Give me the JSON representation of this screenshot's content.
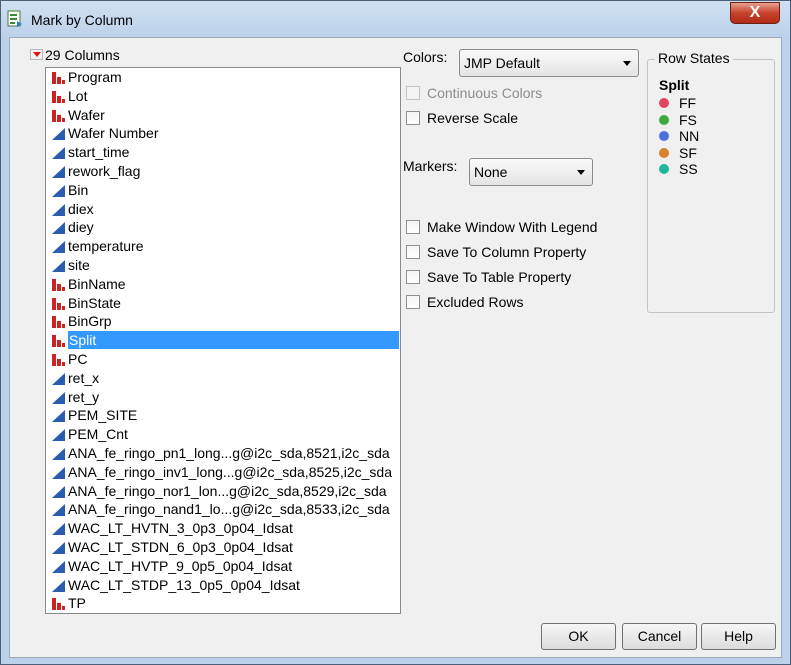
{
  "window": {
    "title": "Mark by Column",
    "close_label": "X"
  },
  "columns": {
    "header": "29 Columns",
    "items": [
      {
        "label": "Program",
        "type": "nominal"
      },
      {
        "label": "Lot",
        "type": "nominal"
      },
      {
        "label": "Wafer",
        "type": "nominal"
      },
      {
        "label": "Wafer Number",
        "type": "continuous"
      },
      {
        "label": "start_time",
        "type": "continuous"
      },
      {
        "label": "rework_flag",
        "type": "continuous"
      },
      {
        "label": "Bin",
        "type": "continuous"
      },
      {
        "label": "diex",
        "type": "continuous"
      },
      {
        "label": "diey",
        "type": "continuous"
      },
      {
        "label": "temperature",
        "type": "continuous"
      },
      {
        "label": "site",
        "type": "continuous"
      },
      {
        "label": "BinName",
        "type": "nominal"
      },
      {
        "label": "BinState",
        "type": "nominal"
      },
      {
        "label": "BinGrp",
        "type": "nominal"
      },
      {
        "label": "Split",
        "type": "nominal",
        "selected": true
      },
      {
        "label": "PC",
        "type": "nominal"
      },
      {
        "label": "ret_x",
        "type": "continuous"
      },
      {
        "label": "ret_y",
        "type": "continuous"
      },
      {
        "label": "PEM_SITE",
        "type": "continuous"
      },
      {
        "label": "PEM_Cnt",
        "type": "continuous"
      },
      {
        "label": "ANA_fe_ringo_pn1_long...g@i2c_sda,8521,i2c_sda",
        "type": "continuous"
      },
      {
        "label": "ANA_fe_ringo_inv1_long...g@i2c_sda,8525,i2c_sda",
        "type": "continuous"
      },
      {
        "label": "ANA_fe_ringo_nor1_lon...g@i2c_sda,8529,i2c_sda",
        "type": "continuous"
      },
      {
        "label": "ANA_fe_ringo_nand1_lo...g@i2c_sda,8533,i2c_sda",
        "type": "continuous"
      },
      {
        "label": "WAC_LT_HVTN_3_0p3_0p04_Idsat",
        "type": "continuous"
      },
      {
        "label": "WAC_LT_STDN_6_0p3_0p04_Idsat",
        "type": "continuous"
      },
      {
        "label": "WAC_LT_HVTP_9_0p5_0p04_Idsat",
        "type": "continuous"
      },
      {
        "label": "WAC_LT_STDP_13_0p5_0p04_Idsat",
        "type": "continuous"
      },
      {
        "label": "TP",
        "type": "nominal"
      }
    ]
  },
  "colors": {
    "label": "Colors:",
    "value": "JMP Default"
  },
  "markers": {
    "label": "Markers:",
    "value": "None"
  },
  "options": {
    "continuous_colors": "Continuous Colors",
    "reverse_scale": "Reverse Scale",
    "make_window_legend": "Make Window With Legend",
    "save_column_property": "Save To Column Property",
    "save_table_property": "Save To Table Property",
    "excluded_rows": "Excluded Rows"
  },
  "row_states": {
    "title": "Row States",
    "legend_title": "Split",
    "items": [
      {
        "label": "FF",
        "color": "#e0455e"
      },
      {
        "label": "FS",
        "color": "#3aad3a"
      },
      {
        "label": "NN",
        "color": "#4a74d9"
      },
      {
        "label": "SF",
        "color": "#d8822a"
      },
      {
        "label": "SS",
        "color": "#1fb89a"
      }
    ]
  },
  "buttons": {
    "ok": "OK",
    "cancel": "Cancel",
    "help": "Help"
  },
  "icon_colors": {
    "nominal": "#cc2222",
    "continuous": "#2a5db0"
  }
}
